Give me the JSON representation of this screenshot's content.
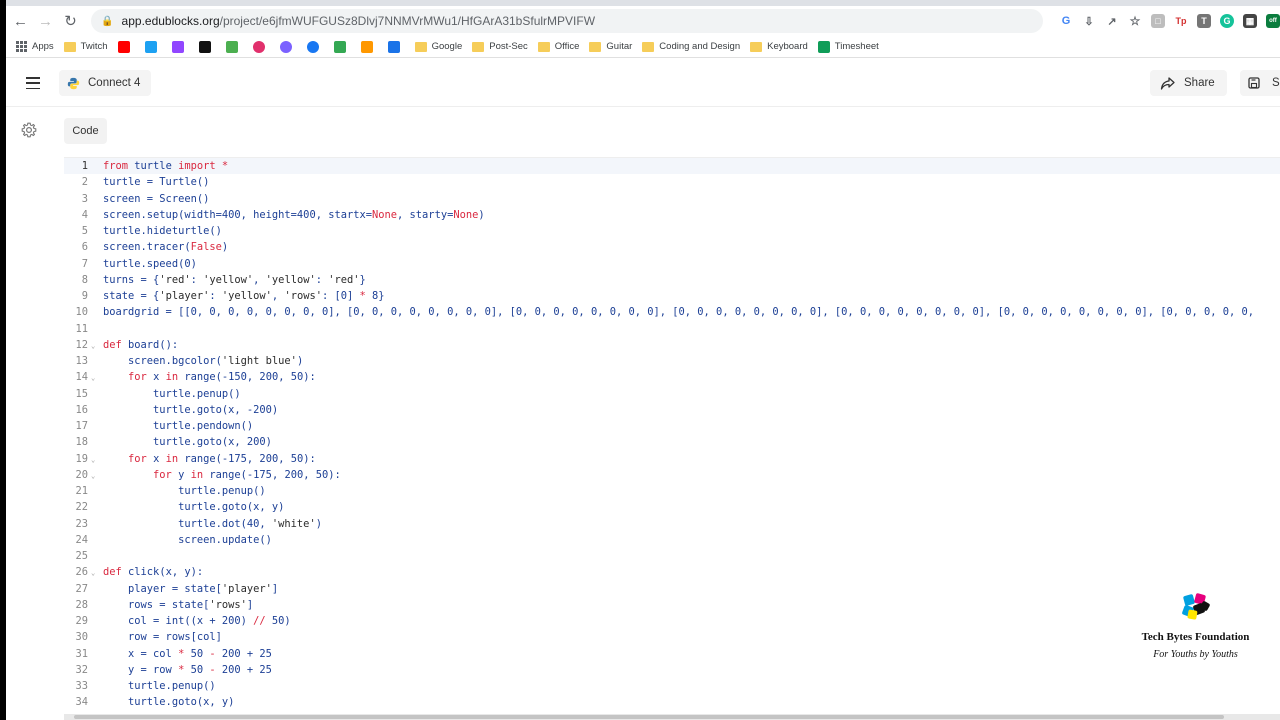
{
  "browser": {
    "url_domain": "app.edublocks.org",
    "url_path": "/project/e6jfmWUFGUSz8Dlvj7NNMVrMWu1/HfGArA31bSfulrMPVIFW",
    "bookmarks": [
      {
        "label": "Apps",
        "icon": "apps-grid-icon"
      },
      {
        "label": "Twitch",
        "icon": "folder-icon"
      },
      {
        "label": "",
        "icon": "youtube-icon",
        "color": "#ff0000"
      },
      {
        "label": "",
        "icon": "twitter-icon",
        "color": "#1da1f2"
      },
      {
        "label": "",
        "icon": "twitch-icon",
        "color": "#9146ff"
      },
      {
        "label": "",
        "icon": "tiktok-icon",
        "color": "#111111"
      },
      {
        "label": "",
        "icon": "image-icon",
        "color": "#4caf50"
      },
      {
        "label": "",
        "icon": "instagram-icon",
        "color": "#e1306c"
      },
      {
        "label": "",
        "icon": "messenger-icon",
        "color": "#7b61ff"
      },
      {
        "label": "",
        "icon": "facebook-icon",
        "color": "#1877f2"
      },
      {
        "label": "",
        "icon": "maps-icon",
        "color": "#34a853"
      },
      {
        "label": "",
        "icon": "pinwheel-icon",
        "color": "#ff9800"
      },
      {
        "label": "",
        "icon": "calendar-icon",
        "color": "#1a73e8"
      },
      {
        "label": "Google",
        "icon": "folder-icon"
      },
      {
        "label": "Post-Sec",
        "icon": "folder-icon"
      },
      {
        "label": "Office",
        "icon": "folder-icon"
      },
      {
        "label": "Guitar",
        "icon": "folder-icon"
      },
      {
        "label": "Coding and Design",
        "icon": "folder-icon"
      },
      {
        "label": "Keyboard",
        "icon": "folder-icon"
      },
      {
        "label": "Timesheet",
        "icon": "sheets-icon",
        "color": "#0f9d58"
      }
    ]
  },
  "header": {
    "project_name": "Connect 4",
    "share_label": "Share",
    "save_label": "Sa"
  },
  "workspace": {
    "tab_label": "Code"
  },
  "editor": {
    "lines": [
      {
        "n": "1",
        "fold": false,
        "tokens": [
          [
            "kw",
            "from"
          ],
          [
            "p",
            " turtle "
          ],
          [
            "kw",
            "import"
          ],
          [
            "lit",
            " *"
          ]
        ]
      },
      {
        "n": "2",
        "fold": false,
        "tokens": [
          [
            "p",
            "turtle = Turtle()"
          ]
        ]
      },
      {
        "n": "3",
        "fold": false,
        "tokens": [
          [
            "p",
            "screen = Screen()"
          ]
        ]
      },
      {
        "n": "4",
        "fold": false,
        "tokens": [
          [
            "p",
            "screen.setup(width=400, height=400, startx="
          ],
          [
            "lit",
            "None"
          ],
          [
            "p",
            ", starty="
          ],
          [
            "lit",
            "None"
          ],
          [
            "p",
            ")"
          ]
        ]
      },
      {
        "n": "5",
        "fold": false,
        "tokens": [
          [
            "p",
            "turtle.hideturtle()"
          ]
        ]
      },
      {
        "n": "6",
        "fold": false,
        "tokens": [
          [
            "p",
            "screen.tracer("
          ],
          [
            "lit",
            "False"
          ],
          [
            "p",
            ")"
          ]
        ]
      },
      {
        "n": "7",
        "fold": false,
        "tokens": [
          [
            "p",
            "turtle.speed(0)"
          ]
        ]
      },
      {
        "n": "8",
        "fold": false,
        "tokens": [
          [
            "p",
            "turns = {"
          ],
          [
            "str",
            "'red'"
          ],
          [
            "p",
            ": "
          ],
          [
            "str",
            "'yellow'"
          ],
          [
            "p",
            ", "
          ],
          [
            "str",
            "'yellow'"
          ],
          [
            "p",
            ": "
          ],
          [
            "str",
            "'red'"
          ],
          [
            "p",
            "}"
          ]
        ]
      },
      {
        "n": "9",
        "fold": false,
        "tokens": [
          [
            "p",
            "state = {"
          ],
          [
            "str",
            "'player'"
          ],
          [
            "p",
            ": "
          ],
          [
            "str",
            "'yellow'"
          ],
          [
            "p",
            ", "
          ],
          [
            "str",
            "'rows'"
          ],
          [
            "p",
            ": [0] "
          ],
          [
            "lit",
            "*"
          ],
          [
            "p",
            " 8}"
          ]
        ]
      },
      {
        "n": "10",
        "fold": false,
        "tokens": [
          [
            "p",
            "boardgrid = [[0, 0, 0, 0, 0, 0, 0, 0], [0, 0, 0, 0, 0, 0, 0, 0], [0, 0, 0, 0, 0, 0, 0, 0], [0, 0, 0, 0, 0, 0, 0, 0], [0, 0, 0, 0, 0, 0, 0, 0], [0, 0, 0, 0, 0, 0, 0, 0], [0, 0, 0, 0, 0,"
          ]
        ]
      },
      {
        "n": "11",
        "fold": false,
        "tokens": [
          [
            "p",
            ""
          ]
        ]
      },
      {
        "n": "12",
        "fold": true,
        "tokens": [
          [
            "kw",
            "def"
          ],
          [
            "p",
            " board():"
          ]
        ]
      },
      {
        "n": "13",
        "fold": false,
        "tokens": [
          [
            "p",
            "    screen.bgcolor("
          ],
          [
            "str",
            "'light blue'"
          ],
          [
            "p",
            ")"
          ]
        ]
      },
      {
        "n": "14",
        "fold": true,
        "tokens": [
          [
            "p",
            "    "
          ],
          [
            "kw",
            "for"
          ],
          [
            "p",
            " x "
          ],
          [
            "kw",
            "in"
          ],
          [
            "p",
            " range(-150, 200, 50):"
          ]
        ]
      },
      {
        "n": "15",
        "fold": false,
        "tokens": [
          [
            "p",
            "        turtle.penup()"
          ]
        ]
      },
      {
        "n": "16",
        "fold": false,
        "tokens": [
          [
            "p",
            "        turtle.goto(x, -200)"
          ]
        ]
      },
      {
        "n": "17",
        "fold": false,
        "tokens": [
          [
            "p",
            "        turtle.pendown()"
          ]
        ]
      },
      {
        "n": "18",
        "fold": false,
        "tokens": [
          [
            "p",
            "        turtle.goto(x, 200)"
          ]
        ]
      },
      {
        "n": "19",
        "fold": true,
        "tokens": [
          [
            "p",
            "    "
          ],
          [
            "kw",
            "for"
          ],
          [
            "p",
            " x "
          ],
          [
            "kw",
            "in"
          ],
          [
            "p",
            " range(-175, 200, 50):"
          ]
        ]
      },
      {
        "n": "20",
        "fold": true,
        "tokens": [
          [
            "p",
            "        "
          ],
          [
            "kw",
            "for"
          ],
          [
            "p",
            " y "
          ],
          [
            "kw",
            "in"
          ],
          [
            "p",
            " range(-175, 200, 50):"
          ]
        ]
      },
      {
        "n": "21",
        "fold": false,
        "tokens": [
          [
            "p",
            "            turtle.penup()"
          ]
        ]
      },
      {
        "n": "22",
        "fold": false,
        "tokens": [
          [
            "p",
            "            turtle.goto(x, y)"
          ]
        ]
      },
      {
        "n": "23",
        "fold": false,
        "tokens": [
          [
            "p",
            "            turtle.dot(40, "
          ],
          [
            "str",
            "'white'"
          ],
          [
            "p",
            ")"
          ]
        ]
      },
      {
        "n": "24",
        "fold": false,
        "tokens": [
          [
            "p",
            "            screen.update()"
          ]
        ]
      },
      {
        "n": "25",
        "fold": false,
        "tokens": [
          [
            "p",
            ""
          ]
        ]
      },
      {
        "n": "26",
        "fold": true,
        "tokens": [
          [
            "kw",
            "def"
          ],
          [
            "p",
            " click(x, y):"
          ]
        ]
      },
      {
        "n": "27",
        "fold": false,
        "tokens": [
          [
            "p",
            "    player = state["
          ],
          [
            "str",
            "'player'"
          ],
          [
            "p",
            "]"
          ]
        ]
      },
      {
        "n": "28",
        "fold": false,
        "tokens": [
          [
            "p",
            "    rows = state["
          ],
          [
            "str",
            "'rows'"
          ],
          [
            "p",
            "]"
          ]
        ]
      },
      {
        "n": "29",
        "fold": false,
        "tokens": [
          [
            "p",
            "    col = int((x + 200) "
          ],
          [
            "lit",
            "//"
          ],
          [
            "p",
            " 50)"
          ]
        ]
      },
      {
        "n": "30",
        "fold": false,
        "tokens": [
          [
            "p",
            "    row = rows[col]"
          ]
        ]
      },
      {
        "n": "31",
        "fold": false,
        "tokens": [
          [
            "p",
            "    x = col "
          ],
          [
            "lit",
            "*"
          ],
          [
            "p",
            " 50 "
          ],
          [
            "lit",
            "-"
          ],
          [
            "p",
            " 200 + 25"
          ]
        ]
      },
      {
        "n": "32",
        "fold": false,
        "tokens": [
          [
            "p",
            "    y = row "
          ],
          [
            "lit",
            "*"
          ],
          [
            "p",
            " 50 "
          ],
          [
            "lit",
            "-"
          ],
          [
            "p",
            " 200 + 25"
          ]
        ]
      },
      {
        "n": "33",
        "fold": false,
        "tokens": [
          [
            "p",
            "    turtle.penup()"
          ]
        ]
      },
      {
        "n": "34",
        "fold": false,
        "tokens": [
          [
            "p",
            "    turtle.goto(x, y)"
          ]
        ]
      }
    ]
  },
  "watermark": {
    "title": "Tech Bytes Foundation",
    "subtitle": "For Youths by Youths"
  }
}
